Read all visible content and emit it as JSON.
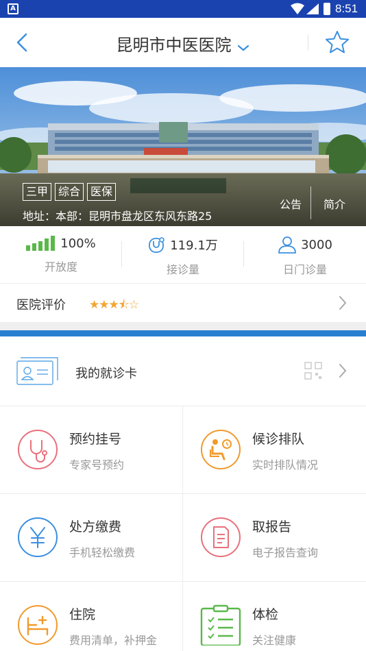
{
  "status_bar": {
    "app_icon_letter": "A",
    "time": "8:51"
  },
  "header": {
    "title": "昆明市中医医院"
  },
  "banner": {
    "badges": [
      "三甲",
      "综合",
      "医保"
    ],
    "address": "地址：本部：昆明市盘龙区东风东路25",
    "notice_label": "公告",
    "intro_label": "简介"
  },
  "stats": [
    {
      "value": "100%",
      "label": "开放度",
      "icon": "signal-bars-icon"
    },
    {
      "value": "119.1万",
      "label": "接诊量",
      "icon": "stethoscope-badge-icon"
    },
    {
      "value": "3000",
      "label": "日门诊量",
      "icon": "person-icon"
    }
  ],
  "rating": {
    "label": "医院评价",
    "stars": 3.5
  },
  "card": {
    "label": "我的就诊卡"
  },
  "services": [
    {
      "title": "预约挂号",
      "subtitle": "专家号预约",
      "icon": "stethoscope-icon",
      "color": "#e8707c"
    },
    {
      "title": "候诊排队",
      "subtitle": "实时排队情况",
      "icon": "waiting-chair-icon",
      "color": "#f19a2c"
    },
    {
      "title": "处方缴费",
      "subtitle": "手机轻松缴费",
      "icon": "yuan-icon",
      "color": "#3a8fe0"
    },
    {
      "title": "取报告",
      "subtitle": "电子报告查询",
      "icon": "report-icon",
      "color": "#e8707c"
    },
    {
      "title": "住院",
      "subtitle": "费用清单，补押金",
      "icon": "hospital-bed-icon",
      "color": "#f19a2c"
    },
    {
      "title": "体检",
      "subtitle": "关注健康",
      "icon": "checklist-icon",
      "color": "#5ab84a"
    }
  ],
  "colors": {
    "status_bar": "#1a43b0",
    "accent_blue": "#2a7fd0",
    "star_orange": "#f3a531",
    "signal_green": "#5ab84a"
  }
}
